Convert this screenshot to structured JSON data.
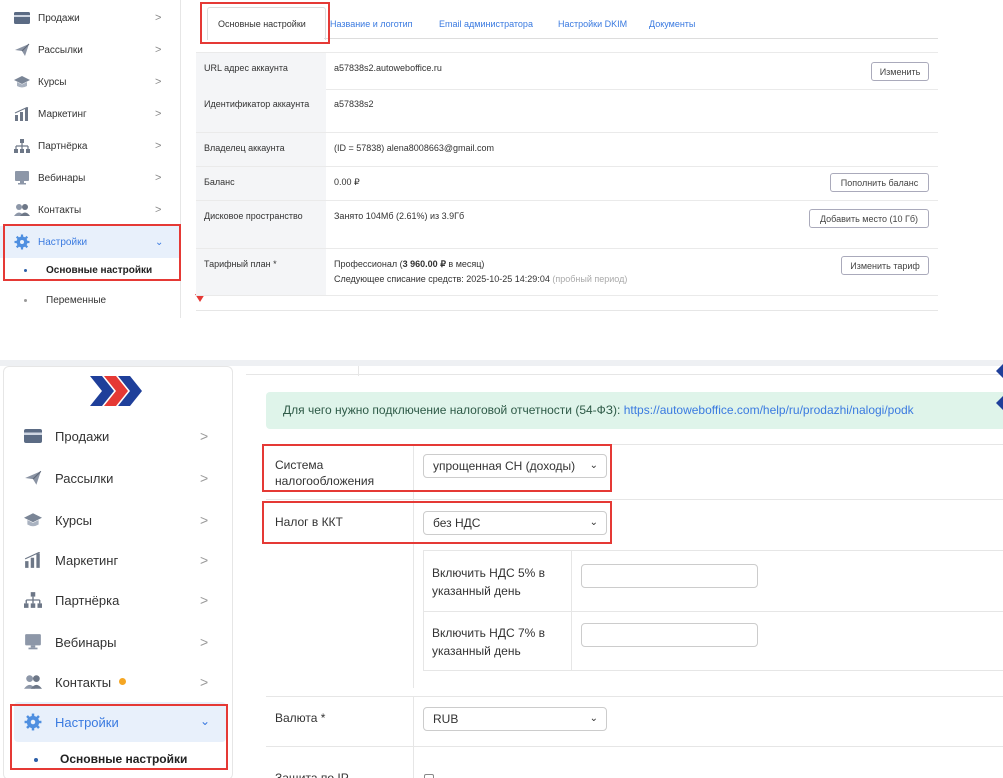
{
  "top": {
    "sidebar": {
      "items": [
        {
          "label": "Продажи",
          "icon": "card-icon"
        },
        {
          "label": "Рассылки",
          "icon": "paper-plane-icon"
        },
        {
          "label": "Курсы",
          "icon": "graduation-cap-icon"
        },
        {
          "label": "Маркетинг",
          "icon": "bar-chart-icon"
        },
        {
          "label": "Партнёрка",
          "icon": "sitemap-icon"
        },
        {
          "label": "Вебинары",
          "icon": "monitor-icon"
        },
        {
          "label": "Контакты",
          "icon": "users-icon"
        },
        {
          "label": "Настройки",
          "icon": "gear-icon"
        }
      ],
      "sub_items": [
        "Основные настройки",
        "Переменные"
      ]
    },
    "tabs": [
      "Основные настройки",
      "Название и логотип",
      "Email администратора",
      "Настройки DKIM",
      "Документы"
    ],
    "rows": {
      "url": {
        "label": "URL адрес аккаунта",
        "value": "a57838s2.autoweboffice.ru",
        "button": "Изменить"
      },
      "id": {
        "label": "Идентификатор аккаунта",
        "value": "a57838s2"
      },
      "owner": {
        "label": "Владелец аккаунта",
        "value": "(ID = 57838) alena8008663@gmail.com"
      },
      "balance": {
        "label": "Баланс",
        "value": "0.00 ₽",
        "button": "Пополнить баланс"
      },
      "disk": {
        "label": "Дисковое пространство",
        "value": "Занято 104Мб (2.61%) из 3.9Гб",
        "button": "Добавить место (10 Гб)"
      },
      "plan": {
        "label": "Тарифный план *",
        "value_prefix": "Профессионал (",
        "value_bold": "3 960.00 ₽",
        "value_suffix": " в месяц)",
        "next_charge": "Следующее списание средств: 2025-10-25 14:29:04",
        "trial": "(пробный период)",
        "button": "Изменить тариф"
      }
    }
  },
  "bottom": {
    "sidebar": {
      "items": [
        {
          "label": "Продажи",
          "icon": "card-icon"
        },
        {
          "label": "Рассылки",
          "icon": "paper-plane-icon"
        },
        {
          "label": "Курсы",
          "icon": "graduation-cap-icon"
        },
        {
          "label": "Маркетинг",
          "icon": "bar-chart-icon"
        },
        {
          "label": "Партнёрка",
          "icon": "sitemap-icon"
        },
        {
          "label": "Вебинары",
          "icon": "monitor-icon"
        },
        {
          "label": "Контакты",
          "icon": "users-icon"
        },
        {
          "label": "Настройки",
          "icon": "gear-icon"
        }
      ],
      "sub_items": [
        "Основные настройки"
      ]
    },
    "info_text": "Для чего нужно подключение налоговой отчетности (54-ФЗ): ",
    "info_link": "https://autoweboffice.com/help/ru/prodazhi/nalogi/podk",
    "tax_system": {
      "label": "Система налогообложения",
      "value": "упрощенная СН (доходы)"
    },
    "kkt_tax": {
      "label": "Налог в ККТ",
      "value": "без НДС"
    },
    "vat5": {
      "label": "Включить НДС 5% в указанный день",
      "value": ""
    },
    "vat7": {
      "label": "Включить НДС 7% в указанный день",
      "value": ""
    },
    "currency": {
      "label": "Валюта *",
      "value": "RUB"
    },
    "ip_protection": {
      "label": "Защита по IP"
    }
  },
  "colors": {
    "accent": "#3a7ae0",
    "highlight_red": "#e53935",
    "brand_red": "#e53935",
    "brand_blue": "#1f3f9a",
    "active_bg": "#e8f0fb",
    "label_bg": "#f4f5f7",
    "info_bg": "#dff4ea",
    "badge": "#f5a623"
  }
}
